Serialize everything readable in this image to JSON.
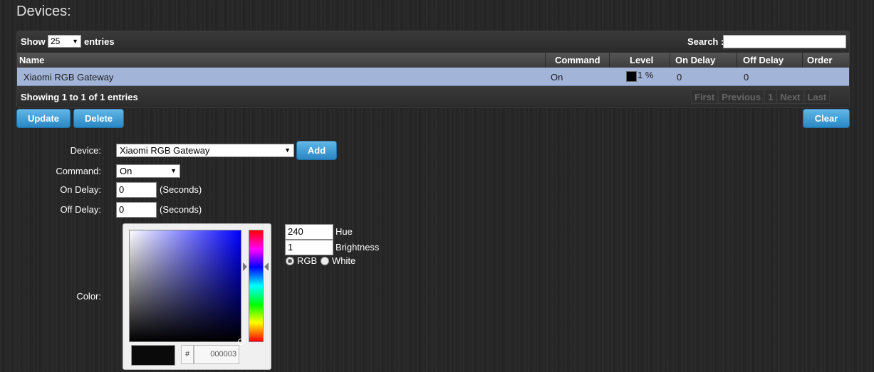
{
  "page": {
    "title": "Devices:"
  },
  "table": {
    "show_label": "Show",
    "page_size": "25",
    "entries_label": "entries",
    "search_label": "Search :",
    "search_value": "",
    "columns": [
      "Name",
      "Command",
      "Level",
      "On Delay",
      "Off Delay",
      "Order"
    ],
    "rows": [
      {
        "name": "Xiaomi RGB Gateway",
        "command": "On",
        "level": "1 %",
        "level_color": "#000000",
        "on_delay": "0",
        "off_delay": "0",
        "order": ""
      }
    ],
    "info": "Showing 1 to 1 of 1 entries",
    "pager": [
      "First",
      "Previous",
      "1",
      "Next",
      "Last"
    ]
  },
  "actions": {
    "update": "Update",
    "delete": "Delete",
    "clear": "Clear",
    "add": "Add"
  },
  "form": {
    "device_label": "Device:",
    "device_value": "Xiaomi RGB Gateway",
    "command_label": "Command:",
    "command_value": "On",
    "on_delay_label": "On Delay:",
    "on_delay_value": "0",
    "off_delay_label": "Off Delay:",
    "off_delay_value": "0",
    "seconds_suffix": "(Seconds)",
    "color_label": "Color:"
  },
  "color_picker": {
    "hex_prefix": "#",
    "hex_value": "000003",
    "hue_value": "240",
    "hue_label": "Hue",
    "brightness_value": "1",
    "brightness_label": "Brightness",
    "mode_rgb": "RGB",
    "mode_white": "White",
    "selected_mode": "RGB",
    "preview_color": "#0a0a0a"
  }
}
